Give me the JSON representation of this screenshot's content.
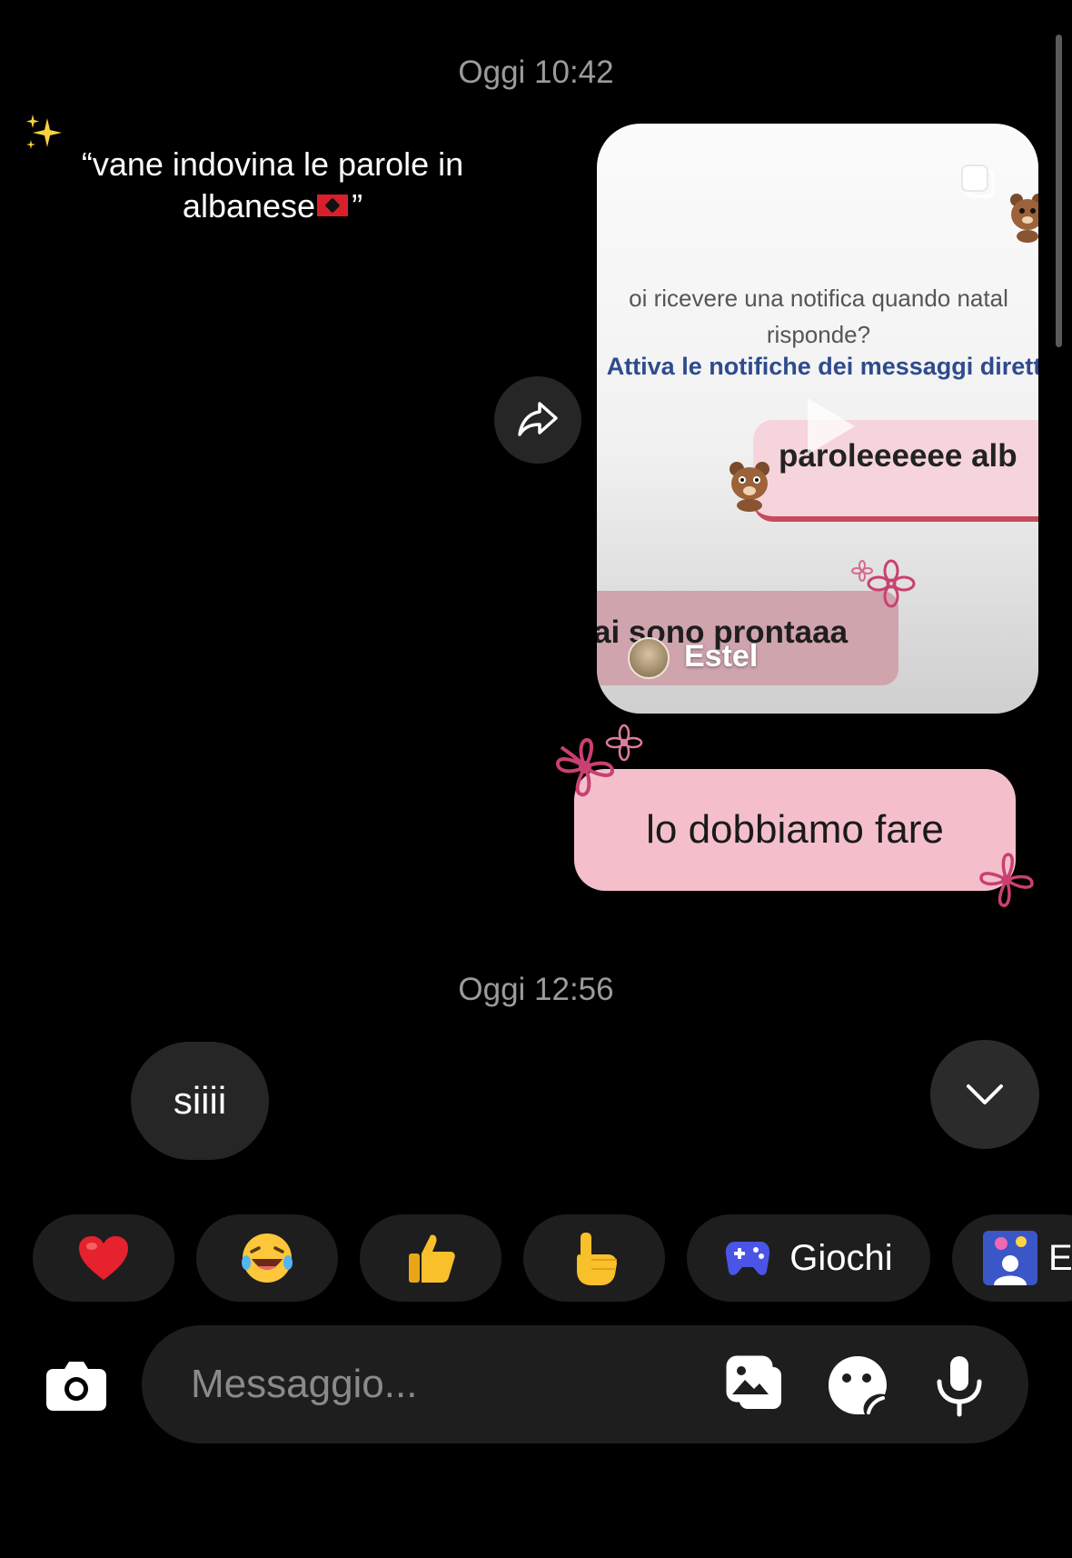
{
  "conversation": {
    "timestamps": [
      "Oggi 10:42",
      "Oggi 12:56"
    ]
  },
  "shared_post": {
    "caption_line1": "“vane indovina le parole in",
    "caption_line2": "albanese",
    "caption_end": "”",
    "video_text_line1": "oi ricevere una notifica quando natal",
    "video_text_line2": "risponde?",
    "video_text_cta": "Attiva le notifiche dei messaggi dirett",
    "video_pill1": "paroleeeeee alb",
    "video_pill2": "ai sono prontaaa",
    "username": "Estel"
  },
  "messages": {
    "outgoing": "lo dobbiamo fare",
    "incoming": "siiii"
  },
  "quick_reactions": {
    "emojis": [
      "❤️",
      "😂",
      "👍",
      "👆"
    ],
    "games_label": "Giochi",
    "effects_label_partial": "E"
  },
  "composer": {
    "placeholder": "Messaggio..."
  },
  "icons": {
    "share": "share-icon",
    "scroll_down": "chevron-down-icon",
    "camera": "camera-icon",
    "gallery": "gallery-icon",
    "sticker": "sticker-icon",
    "mic": "microphone-icon",
    "games": "gamepad-icon"
  },
  "colors": {
    "outgoing_bubble": "#f4bfcb",
    "incoming_bubble": "#262626",
    "background": "#000000",
    "chip_background": "#1e1e1e",
    "games_icon": "#4a55e8",
    "flower_deco": "#c94071"
  }
}
